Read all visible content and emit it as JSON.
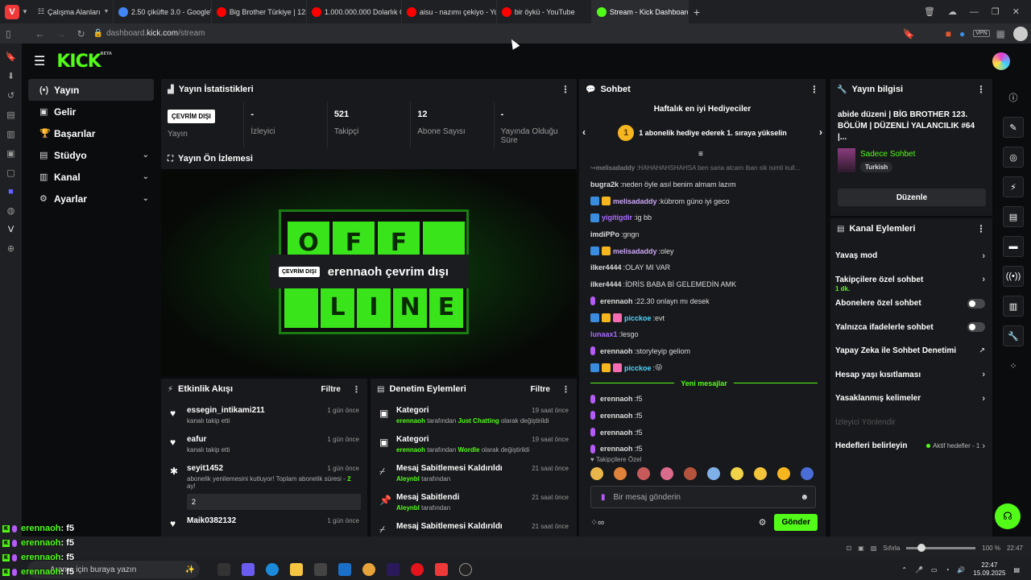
{
  "browser": {
    "workspace_label": "Çalışma Alanları",
    "tabs": [
      {
        "label": "2.50 çiküfte 3.0 - Google'da",
        "fav": "#4285f4"
      },
      {
        "label": "Big Brother Türkiye | 123. B",
        "fav": "#ff0000"
      },
      {
        "label": "1.000.000.000 Dolarlık Çiko",
        "fav": "#ff0000"
      },
      {
        "label": "aisu - nazımı çekiyo - YouT",
        "fav": "#ff0000"
      },
      {
        "label": "bir öykü - YouTube",
        "fav": "#ff0000"
      },
      {
        "label": "Stream - Kick Dashboard",
        "fav": "#53fc18"
      }
    ],
    "url_prefix": "dashboard.",
    "url_domain": "kick.com",
    "url_path": "/stream",
    "vpn_label": "VPN",
    "zoom_label": "Sıfırla",
    "zoom_value": "100 %",
    "status_time": "22:47"
  },
  "kick": {
    "logo": "KICK",
    "logo_beta": "BETA"
  },
  "nav": {
    "items": [
      {
        "label": "Yayın",
        "icon": "(•)",
        "name": "stream"
      },
      {
        "label": "Gelir",
        "icon": "▣",
        "name": "revenue"
      },
      {
        "label": "Başarılar",
        "icon": "🏆",
        "name": "achievements"
      },
      {
        "label": "Stüdyo",
        "icon": "▤",
        "name": "studio"
      },
      {
        "label": "Kanal",
        "icon": "▥",
        "name": "channel"
      },
      {
        "label": "Ayarlar",
        "icon": "⚙",
        "name": "settings"
      }
    ]
  },
  "stats": {
    "title": "Yayın İstatistikleri",
    "offline_badge": "ÇEVRİM DIŞI",
    "cols": [
      {
        "value": "",
        "label": "Yayın"
      },
      {
        "value": "-",
        "label": "İzleyici"
      },
      {
        "value": "521",
        "label": "Takipçi"
      },
      {
        "value": "12",
        "label": "Abone Sayısı"
      },
      {
        "value": "-",
        "label": "Yayında Olduğu Süre"
      }
    ]
  },
  "preview": {
    "title": "Yayın Ön İzlemesi",
    "badge": "ÇEVRİM DIŞI",
    "text": "erennaoh çevrim dışı",
    "letters_top": [
      "O",
      "F",
      "F",
      ""
    ],
    "letters_bottom": [
      "",
      "L",
      "I",
      "N",
      "E"
    ]
  },
  "activity": {
    "title": "Etkinlik Akışı",
    "filter": "Filtre",
    "items": [
      {
        "user": "essegin_intikami211",
        "text": "kanalı takip etti",
        "time": "1 gün önce",
        "icon": "♥"
      },
      {
        "user": "eafur",
        "text": "kanalı takip etti",
        "time": "1 gün önce",
        "icon": "♥"
      },
      {
        "user": "seyit1452",
        "text_a": "abonelik yenilemesini kutluyor! Toplam abonelik süresi - ",
        "hl": "2",
        "text_b": " ay!",
        "time": "1 gün önce",
        "icon": "✱",
        "box": "2"
      },
      {
        "user": "Maik0382132",
        "text": "",
        "time": "1 gün önce",
        "icon": "♥"
      }
    ]
  },
  "modact": {
    "title": "Denetim Eylemleri",
    "filter": "Filtre",
    "items": [
      {
        "title": "Kategori",
        "actor": "erennaoh",
        "mid": " tarafından ",
        "hl": "Just Chatting",
        "tail": " olarak değiştirildi",
        "time": "19 saat önce",
        "icon": "▣"
      },
      {
        "title": "Kategori",
        "actor": "erennaoh",
        "mid": " tarafından ",
        "hl": "Wordle",
        "tail": " olarak değiştirildi",
        "time": "19 saat önce",
        "icon": "▣"
      },
      {
        "title": "Mesaj Sabitlemesi Kaldırıldı",
        "actor": "Aleynbl",
        "mid": " tarafından",
        "hl": "",
        "tail": "",
        "time": "21 saat önce",
        "icon": "⌿"
      },
      {
        "title": "Mesaj Sabitlendi",
        "actor": "Aleynbl",
        "mid": " tarafından",
        "hl": "",
        "tail": "",
        "time": "21 saat önce",
        "icon": "📌"
      },
      {
        "title": "Mesaj Sabitlemesi Kaldırıldı",
        "actor": "",
        "mid": "",
        "hl": "",
        "tail": "",
        "time": "21 saat önce",
        "icon": "⌿"
      }
    ]
  },
  "chat": {
    "title": "Sohbet",
    "hype_title": "Haftalık en iyi Hediyeciler",
    "hype_rank": "1",
    "hype_text": "1 abonelik hediye ederek 1. sıraya yükselin",
    "messages": [
      {
        "user": "melisadaddy",
        "text": "HAHAHAHSHAHSA ben sana atcam iban sik isimli kull...",
        "color": "#777",
        "reply": true
      },
      {
        "user": "bugra2k",
        "text": "neden öyle asıl benim almam lazım",
        "color": "#ddd"
      },
      {
        "user": "melisadaddy",
        "text": "kübrom güno iyi geco",
        "color": "#c9a6f5",
        "badges": 2
      },
      {
        "user": "yigitigdir",
        "text": "ig bb",
        "color": "#a86cff",
        "badges": 1
      },
      {
        "user": "imdiPPo",
        "text": "gngn",
        "color": "#ddd"
      },
      {
        "user": "melisadaddy",
        "text": "oley",
        "color": "#c9a6f5",
        "badges": 2
      },
      {
        "user": "ilker4444",
        "text": "OLAY MI VAR",
        "color": "#ddd"
      },
      {
        "user": "ilker4444",
        "text": "İDRİS BABA Bİ GELEMEDİN AMK",
        "color": "#ddd"
      },
      {
        "user": "erennaoh",
        "text": "22.30 onlayn mı desek",
        "color": "#ddd",
        "mic": true
      },
      {
        "user": "picckoe",
        "text": "evt",
        "color": "#4fd6ff",
        "badges": 3
      },
      {
        "user": "lunaax1",
        "text": "lesgo",
        "color": "#a86cff"
      },
      {
        "user": "erennaoh",
        "text": "storyleyip geliom",
        "color": "#ddd",
        "mic": true
      },
      {
        "user": "picckoe",
        "text": "😜",
        "color": "#4fd6ff",
        "badges": 3
      }
    ],
    "new_label": "Yeni mesajlar",
    "new_messages": [
      {
        "user": "erennaoh",
        "text": "f5"
      },
      {
        "user": "erennaoh",
        "text": "f5"
      },
      {
        "user": "erennaoh",
        "text": "f5"
      },
      {
        "user": "erennaoh",
        "text": "f5"
      }
    ],
    "followers_label": "Takipçilere Özel",
    "input_placeholder": "Bir mesaj gönderin",
    "send_label": "Gönder"
  },
  "stream_info": {
    "title": "Yayın bilgisi",
    "stream_title": "abide düzeni | BİG BROTHER 123. BÖLÜM | DÜZENLİ YALANCILIK #64 |...",
    "category": "Sadece Sohbet",
    "language": "Turkish",
    "edit_label": "Düzenle"
  },
  "channel_actions": {
    "title": "Kanal Eylemleri",
    "rows": [
      {
        "label": "Yavaş mod",
        "type": "chevron"
      },
      {
        "label": "Takipçilere özel sohbet",
        "sub": "1 dk.",
        "type": "chevron"
      },
      {
        "label": "Abonelere özel sohbet",
        "type": "toggle"
      },
      {
        "label": "Yalnızca ifadelerle sohbet",
        "type": "toggle"
      },
      {
        "label": "Yapay Zeka ile Sohbet Denetimi",
        "type": "external"
      },
      {
        "label": "Hesap yaşı kısıtlaması",
        "type": "chevron"
      },
      {
        "label": "Yasaklanmış kelimeler",
        "type": "chevron"
      },
      {
        "label": "İzleyici Yönlendir",
        "type": "disabled"
      },
      {
        "label": "Hedefleri belirleyin",
        "type": "goal",
        "status": "Aktif hedefler - 1"
      }
    ]
  },
  "taskbar": {
    "search_placeholder": "Arama için buraya yazın",
    "time": "22:47",
    "date": "15.09.2025"
  },
  "overlay": [
    {
      "user": "erennaoh",
      "text": " : f5"
    },
    {
      "user": "erennaoh",
      "text": " : f5"
    },
    {
      "user": "erennaoh",
      "text": " : f5"
    },
    {
      "user": "erennaoh",
      "text": " : f5"
    }
  ]
}
